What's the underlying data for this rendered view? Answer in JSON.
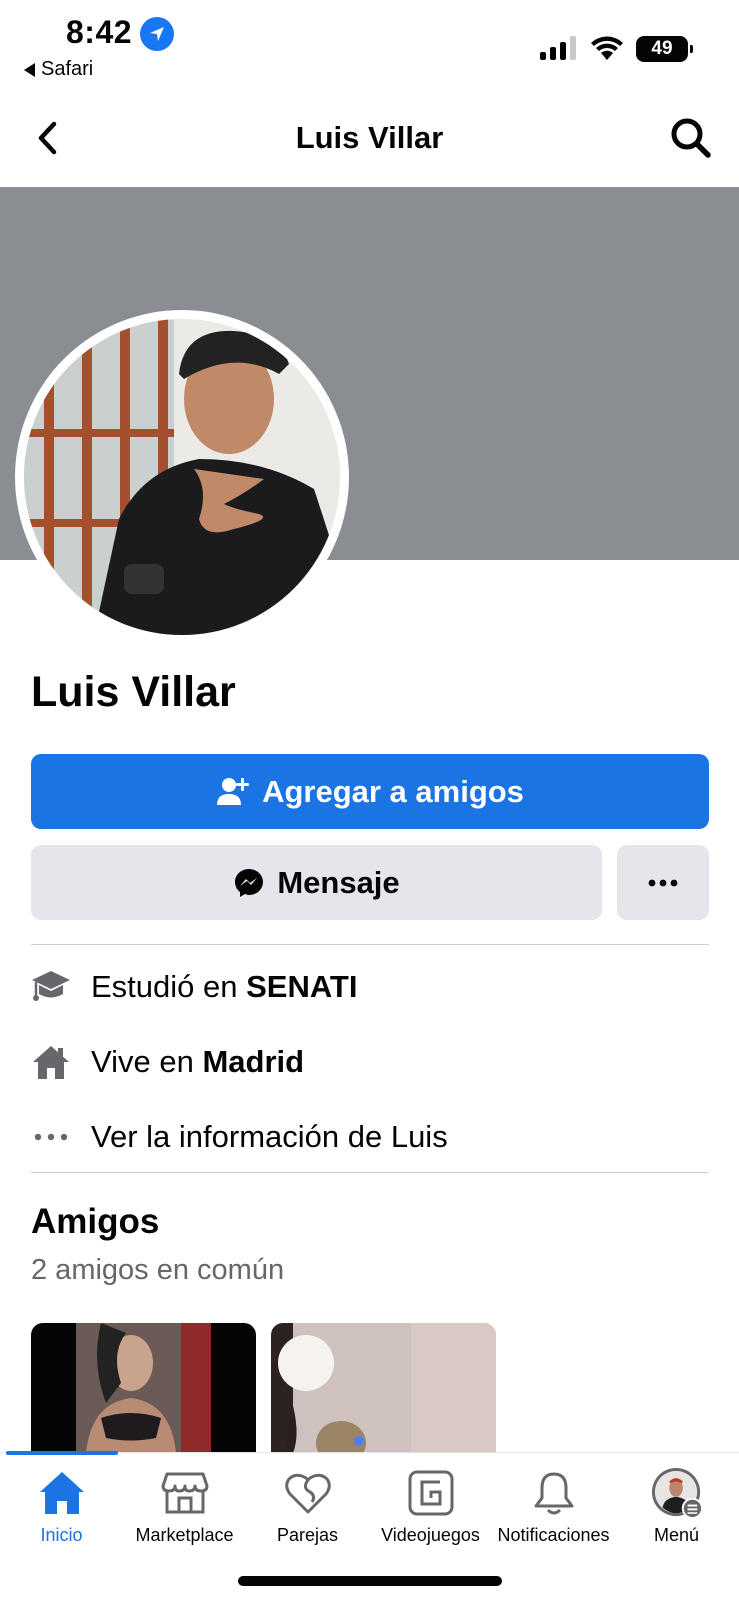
{
  "status_bar": {
    "time": "8:42",
    "back_app": "Safari",
    "battery": "49"
  },
  "header": {
    "title": "Luis Villar",
    "back_icon": "chevron-left-icon",
    "search_icon": "search-icon"
  },
  "profile": {
    "name": "Luis Villar",
    "cover_color": "#8a8d91"
  },
  "actions": {
    "add_friend_label": "Agregar a amigos",
    "message_label": "Mensaje",
    "accent": "#1b74e4"
  },
  "info": {
    "education_prefix": "Estudió en ",
    "education_place": "SENATI",
    "lives_prefix": "Vive en ",
    "lives_place": "Madrid",
    "more_info": "Ver la información de Luis"
  },
  "friends": {
    "title": "Amigos",
    "mutual": "2 amigos en común"
  },
  "tab_bar": {
    "items": [
      {
        "label": "Inicio",
        "icon": "home-icon",
        "active": true
      },
      {
        "label": "Marketplace",
        "icon": "marketplace-icon",
        "active": false
      },
      {
        "label": "Parejas",
        "icon": "dating-heart-icon",
        "active": false
      },
      {
        "label": "Videojuegos",
        "icon": "gaming-icon",
        "active": false
      },
      {
        "label": "Notificaciones",
        "icon": "bell-icon",
        "active": false
      },
      {
        "label": "Menú",
        "icon": "avatar-menu-icon",
        "active": false
      }
    ]
  }
}
